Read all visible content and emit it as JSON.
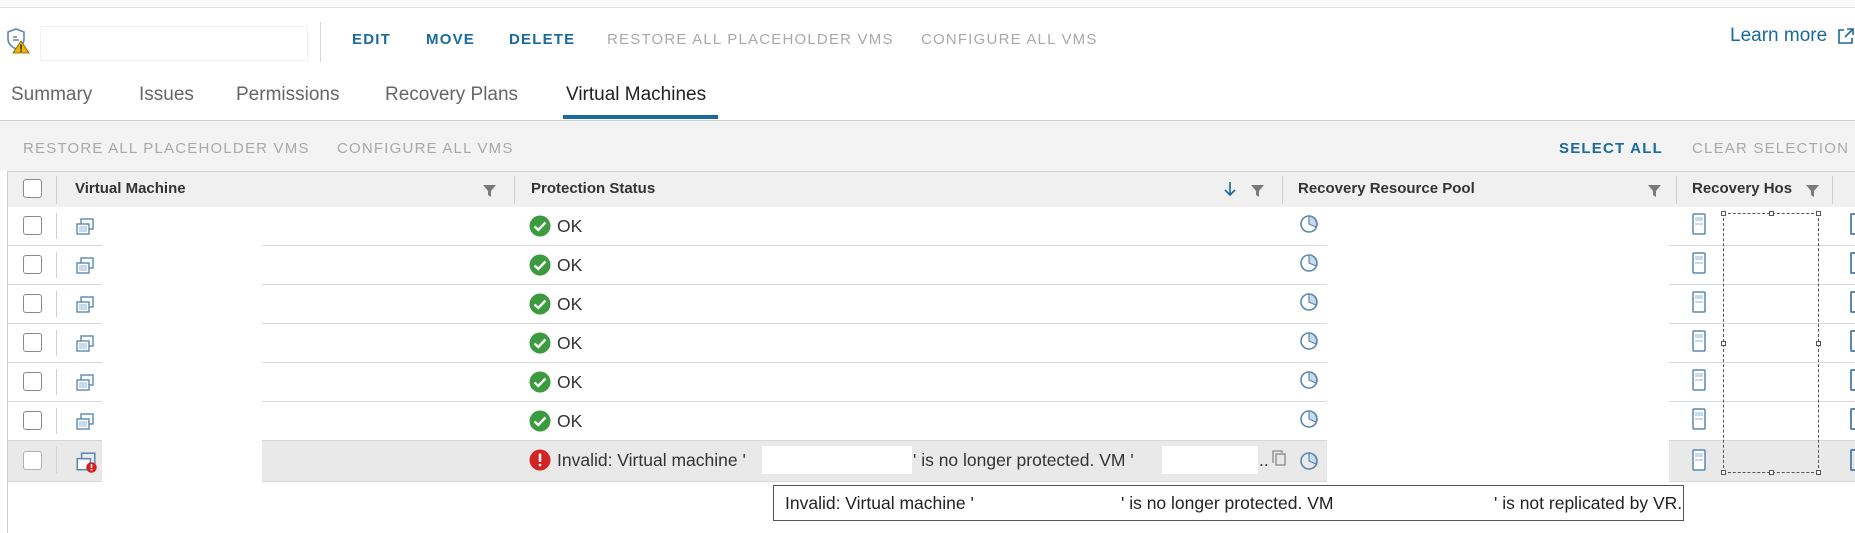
{
  "toolbar": {
    "edit": "EDIT",
    "move": "MOVE",
    "delete": "DELETE",
    "restore_all": "RESTORE ALL PLACEHOLDER VMS",
    "configure_all": "CONFIGURE ALL VMS",
    "learn_more": "Learn more"
  },
  "tabs": [
    "Summary",
    "Issues",
    "Permissions",
    "Recovery Plans",
    "Virtual Machines"
  ],
  "active_tab": "Virtual Machines",
  "grid_toolbar": {
    "restore_all": "RESTORE ALL PLACEHOLDER VMS",
    "configure_all": "CONFIGURE ALL VMS",
    "select_all": "SELECT ALL",
    "clear_selection": "CLEAR SELECTION"
  },
  "columns": [
    "Virtual Machine",
    "Protection Status",
    "Recovery Resource Pool",
    "Recovery Hos"
  ],
  "rows": [
    {
      "status": "OK"
    },
    {
      "status": "OK"
    },
    {
      "status": "OK"
    },
    {
      "status": "OK"
    },
    {
      "status": "OK"
    },
    {
      "status": "OK"
    },
    {
      "status_pre": "Invalid: Virtual machine '",
      "status_mid": "' is no longer protected. VM '",
      "status_end": ".."
    }
  ],
  "tooltip": {
    "part1": "Invalid: Virtual machine '",
    "part2": "' is no longer protected. VM",
    "part3": "' is not replicated by VR."
  },
  "colors": {
    "accent": "#1a6a9c",
    "ok": "#3c9b3f",
    "error": "#d32222",
    "warning": "#f4b400"
  },
  "icons": {
    "protection_group": "shield-warning-icon",
    "vm": "vm-stack-icon",
    "ok": "check-circle-icon",
    "error": "error-circle-icon",
    "pool": "resource-pool-icon",
    "host": "host-server-icon",
    "filter": "filter-icon",
    "sort": "sort-down-icon",
    "external": "external-link-icon",
    "copy": "copy-icon"
  }
}
